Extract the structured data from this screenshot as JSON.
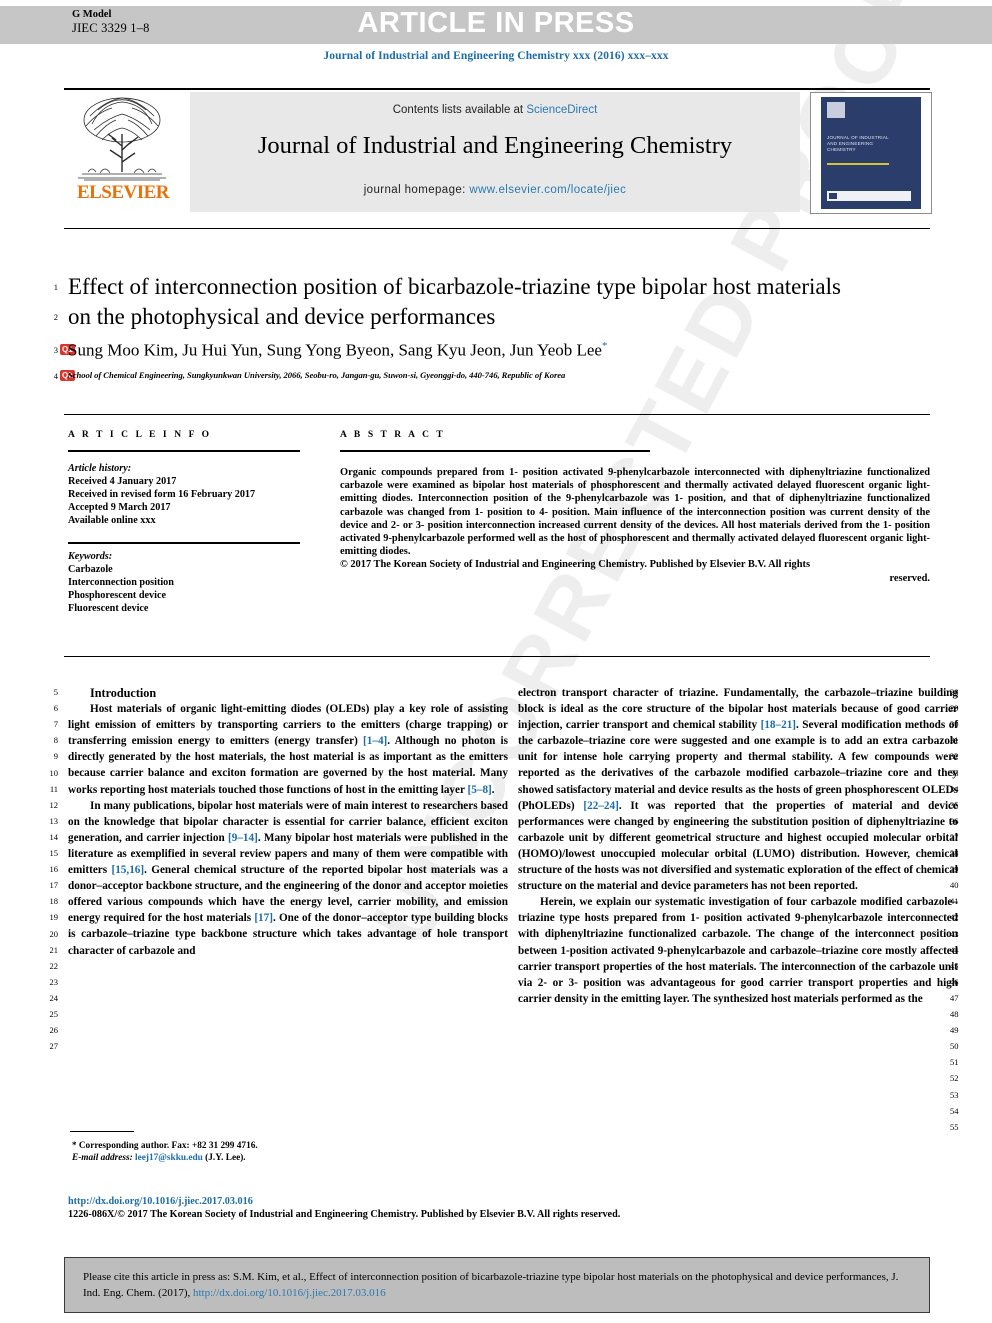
{
  "header": {
    "g_model_l1": "G Model",
    "g_model_l2": "JIEC 3329 1–8",
    "article_in_press": "ARTICLE IN PRESS",
    "journal_ref_line": "Journal of Industrial and Engineering Chemistry xxx (2016) xxx–xxx"
  },
  "masthead": {
    "contents_prefix": "Contents lists available at ",
    "sciencedirect": "ScienceDirect",
    "journal_title": "Journal of Industrial and Engineering Chemistry",
    "homepage_label": "journal homepage:",
    "homepage_url": "www.elsevier.com/locate/jiec",
    "publisher": "ELSEVIER",
    "cover_text": "JOURNAL OF INDUSTRIAL AND ENGINEERING CHEMISTRY"
  },
  "article": {
    "title": "Effect of interconnection position of bicarbazole-triazine type bipolar host materials on the photophysical and device performances",
    "authors": "Sung Moo Kim, Ju Hui Yun, Sung Yong Byeon, Sang Kyu Jeon, Jun Yeob Lee",
    "corresponding_marker": "*",
    "affiliation": "School of Chemical Engineering, Sungkyunkwan University, 2066, Seobu-ro, Jangan-gu, Suwon-si, Gyeonggi-do, 440-746, Republic of Korea",
    "query_badges": [
      "Q1",
      "Q2"
    ]
  },
  "article_info": {
    "heading": "A R T I C L E   I N F O",
    "history_label": "Article history:",
    "history": [
      "Received 4 January 2017",
      "Received in revised form 16 February 2017",
      "Accepted 9 March 2017",
      "Available online xxx"
    ],
    "keywords_label": "Keywords:",
    "keywords": [
      "Carbazole",
      "Interconnection position",
      "Phosphorescent device",
      "Fluorescent device"
    ]
  },
  "abstract": {
    "heading": "A B S T R A C T",
    "body": "Organic compounds prepared from 1- position activated 9-phenylcarbazole interconnected with diphenyltriazine functionalized carbazole were examined as bipolar host materials of phosphorescent and thermally activated delayed fluorescent organic light-emitting diodes. Interconnection position of the 9-phenylcarbazole was 1- position, and that of diphenyltriazine functionalized carbazole was changed from 1- position to 4- position. Main influence of the interconnection position was current density of the device and 2- or 3- position interconnection increased current density of the devices. All host materials derived from the 1- position activated 9-phenylcarbazole performed well as the host of phosphorescent and thermally activated delayed fluorescent organic light-emitting diodes.",
    "copyright": "© 2017 The Korean Society of Industrial and Engineering Chemistry. Published by Elsevier B.V. All rights",
    "copyright_end": "reserved."
  },
  "body": {
    "section_heading": "Introduction",
    "left_paragraphs": [
      "Host materials of organic light-emitting diodes (OLEDs) play a key role of assisting light emission of emitters by transporting carriers to the emitters (charge trapping) or transferring emission energy to emitters (energy transfer) [1–4]. Although no photon is directly generated by the host materials, the host material is as important as the emitters because carrier balance and exciton formation are governed by the host material. Many works reporting host materials touched those functions of host in the emitting layer [5–8].",
      "In many publications, bipolar host materials were of main interest to researchers based on the knowledge that bipolar character is essential for carrier balance, efficient exciton generation, and carrier injection [9–14]. Many bipolar host materials were published in the literature as exemplified in several review papers and many of them were compatible with emitters [15,16]. General chemical structure of the reported bipolar host materials was a donor–acceptor backbone structure, and the engineering of the donor and acceptor moieties offered various compounds which have the energy level, carrier mobility, and emission energy required for the host materials [17]. One of the donor–acceptor type building blocks is carbazole–triazine type backbone structure which takes advantage of hole transport character of carbazole and"
    ],
    "right_paragraphs": [
      "electron transport character of triazine. Fundamentally, the carbazole–triazine building block is ideal as the core structure of the bipolar host materials because of good carrier injection, carrier transport and chemical stability [18–21]. Several modification methods of the carbazole–triazine core were suggested and one example is to add an extra carbazole unit for intense hole carrying property and thermal stability. A few compounds were reported as the derivatives of the carbazole modified carbazole–triazine core and they showed satisfactory material and device results as the hosts of green phosphorescent OLEDs (PhOLEDs) [22–24]. It was reported that the properties of material and device performances were changed by engineering the substitution position of diphenyltriazine to carbazole unit by different geometrical structure and highest occupied molecular orbital (HOMO)/lowest unoccupied molecular orbital (LUMO) distribution. However, chemical structure of the hosts was not diversified and systematic exploration of the effect of chemical structure on the material and device parameters has not been reported.",
      "Herein, we explain our systematic investigation of four carbazole modified carbazole–triazine type hosts prepared from 1- position activated 9-phenylcarbazole interconnected with diphenyltriazine functionalized carbazole. The change of the interconnect position between 1-position activated 9-phenylcarbazole and carbazole–triazine core mostly affected carrier transport properties of the host materials. The interconnection of the carbazole unit via 2- or 3- position was advantageous for good carrier transport properties and high carrier density in the emitting layer. The synthesized host materials performed as the"
    ],
    "left_line_numbers": [
      "5",
      "6",
      "7",
      "8",
      "9",
      "10",
      "11",
      "12",
      "13",
      "14",
      "15",
      "16",
      "17",
      "18",
      "19",
      "20",
      "21",
      "22",
      "23",
      "24",
      "25",
      "26",
      "27"
    ],
    "right_line_numbers": [
      "28",
      "29",
      "30",
      "31",
      "32",
      "33",
      "34",
      "35",
      "36",
      "37",
      "38",
      "39",
      "40",
      "41",
      "42",
      "43",
      "44",
      "45",
      "46",
      "47",
      "48",
      "49",
      "50",
      "51",
      "52",
      "53",
      "54",
      "55"
    ],
    "head_line_numbers": [
      "1",
      "2",
      "3",
      "4"
    ]
  },
  "footnote": {
    "star": "*",
    "corresponding": "Corresponding author. Fax: +82 31 299 4716.",
    "email_label": "E-mail address:",
    "email": "leej17@skku.edu",
    "email_suffix": "(J.Y. Lee)."
  },
  "footer": {
    "doi": "http://dx.doi.org/10.1016/j.jiec.2017.03.016",
    "issn_line": "1226-086X/© 2017 The Korean Society of Industrial and Engineering Chemistry. Published by Elsevier B.V. All rights reserved."
  },
  "cite_box": {
    "text": "Please cite this article in press as: S.M. Kim, et al., Effect of interconnection position of bicarbazole-triazine type bipolar host materials on the photophysical and device performances, J. Ind. Eng. Chem. (2017), ",
    "link": "http://dx.doi.org/10.1016/j.jiec.2017.03.016"
  },
  "watermark": {
    "text": "UNCORRECTED PROOF"
  },
  "colors": {
    "accent_blue": "#1b6ca8",
    "link_blue": "#2a7ab0",
    "elsevier_orange": "#e8710a",
    "band_grey": "#c6c6c6",
    "box_grey": "#bdbdbd",
    "query_red": "#d9352c"
  }
}
